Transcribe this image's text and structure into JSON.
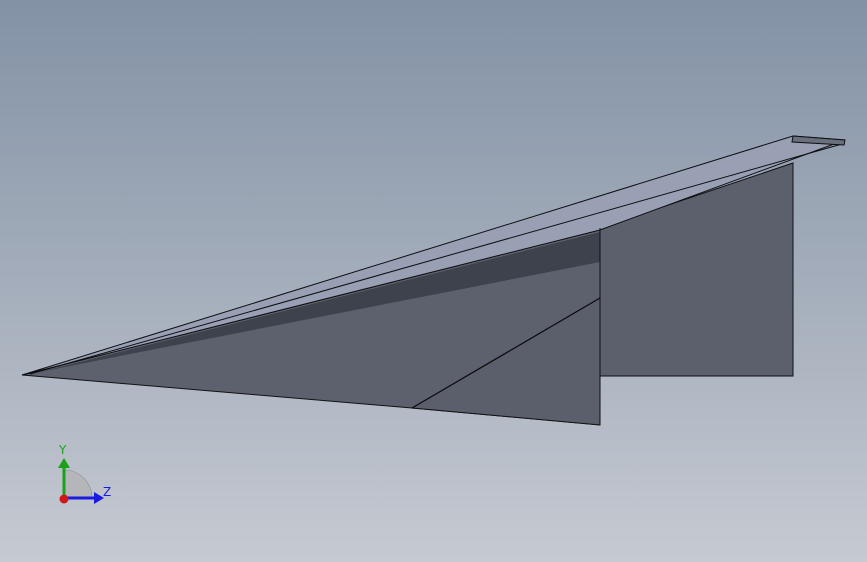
{
  "viewport": {
    "background_top": "#8392a6",
    "background_bottom": "#c6cad2"
  },
  "model": {
    "name": "paper-airplane",
    "face_color": "#5c606c",
    "edge_color": "#0c0e12",
    "top_face_color": "#9aa0b4",
    "shadow_color": "#3e424c"
  },
  "triad": {
    "y_label": "Y",
    "z_label": "Z",
    "y_color": "#1aa11a",
    "z_color": "#1a1ae0",
    "x_color": "#d01818"
  }
}
